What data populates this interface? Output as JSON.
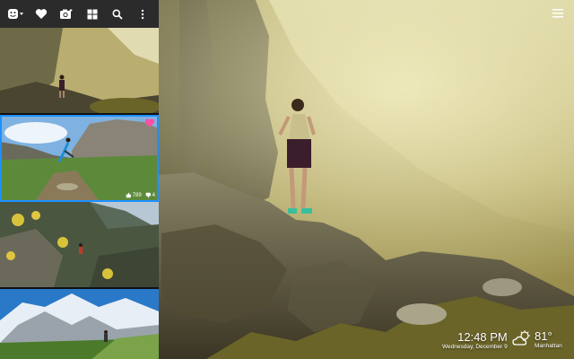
{
  "toolbar": {
    "icons": [
      "face-menu-icon",
      "heart-icon",
      "camera-add-icon",
      "grid-icon",
      "search-icon",
      "more-vert-icon"
    ]
  },
  "thumbnails": [
    {
      "id": "thumb-1"
    },
    {
      "id": "thumb-2",
      "favorited": true,
      "likes": "789",
      "dislikes": "4"
    },
    {
      "id": "thumb-3"
    },
    {
      "id": "thumb-4"
    }
  ],
  "clock": {
    "time": "12:48 PM",
    "date": "Wednesday, December 9"
  },
  "weather": {
    "temperature": "81°",
    "location": "Manhattan",
    "icon": "partly-cloudy-icon"
  },
  "colors": {
    "accent_heart": "#ff4fa3",
    "sidebar": "#1e1e1e",
    "toolbar": "#2b2b2b"
  }
}
